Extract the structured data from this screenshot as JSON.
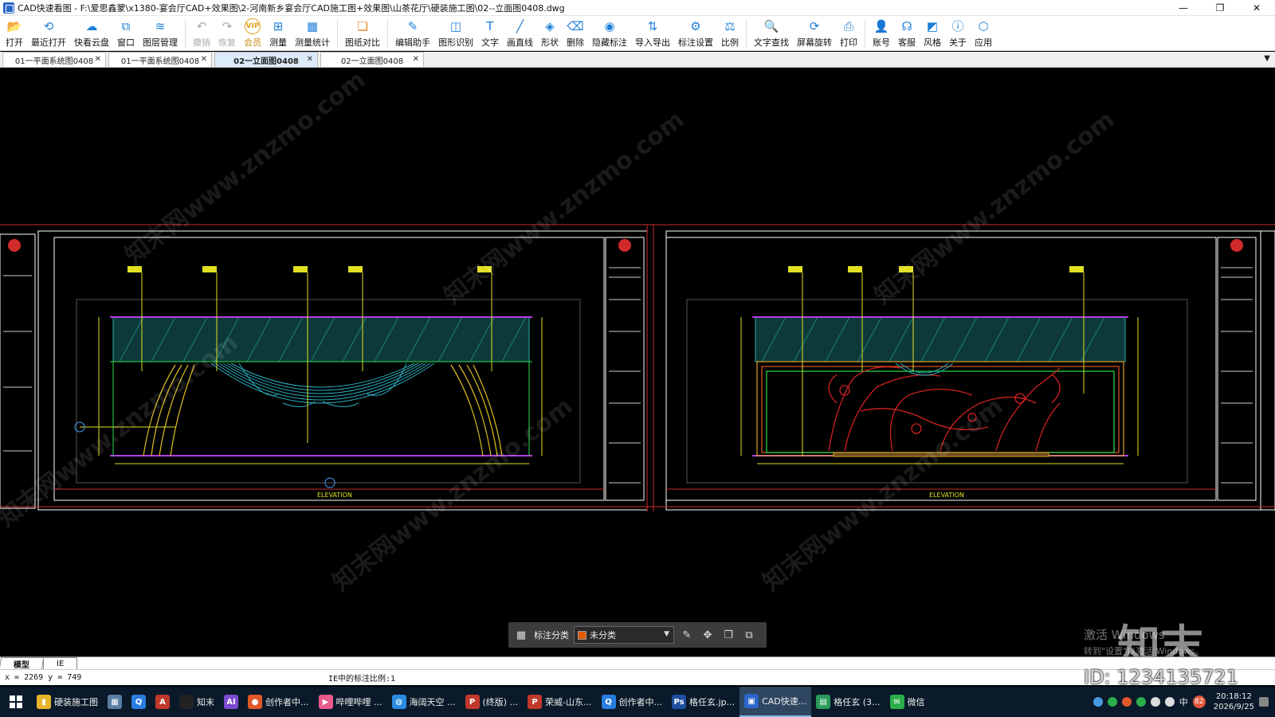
{
  "window": {
    "title": "CAD快速看图 - F:\\爱思鑫蒙\\x1380-宴会厅CAD+效果图\\2-河南新乡宴会厅CAD施工图+效果图\\山茶花厅\\硬装施工图\\02--立面图0408.dwg",
    "controls": [
      "—",
      "❐",
      "✕"
    ]
  },
  "toolbar": {
    "items": [
      {
        "label": "打开",
        "icon": "folder-open-icon",
        "glyph": "📂"
      },
      {
        "label": "最近打开",
        "icon": "history-icon",
        "glyph": "⟲"
      },
      {
        "label": "快看云盘",
        "icon": "cloud-icon",
        "glyph": "☁"
      },
      {
        "label": "窗口",
        "icon": "window-icon",
        "glyph": "⧉"
      },
      {
        "label": "图层管理",
        "icon": "layers-icon",
        "glyph": "≋"
      },
      {
        "label": "撤销",
        "icon": "undo-icon",
        "glyph": "↶"
      },
      {
        "label": "恢复",
        "icon": "redo-icon",
        "glyph": "↷"
      },
      {
        "label": "会员",
        "icon": "vip-icon",
        "glyph": "VIP"
      },
      {
        "label": "测量",
        "icon": "ruler-icon",
        "glyph": "⊞"
      },
      {
        "label": "测量统计",
        "icon": "measure-stats-icon",
        "glyph": "▦"
      },
      {
        "label": "图纸对比",
        "icon": "compare-icon",
        "glyph": "❏"
      },
      {
        "label": "编辑助手",
        "icon": "edit-assist-icon",
        "glyph": "✎"
      },
      {
        "label": "图形识别",
        "icon": "shape-recognize-icon",
        "glyph": "◫"
      },
      {
        "label": "文字",
        "icon": "text-icon",
        "glyph": "T"
      },
      {
        "label": "画直线",
        "icon": "line-icon",
        "glyph": "╱"
      },
      {
        "label": "形状",
        "icon": "shape-icon",
        "glyph": "◈"
      },
      {
        "label": "删除",
        "icon": "eraser-icon",
        "glyph": "⌫"
      },
      {
        "label": "隐藏标注",
        "icon": "hide-annotation-icon",
        "glyph": "◉"
      },
      {
        "label": "导入导出",
        "icon": "import-export-icon",
        "glyph": "⇅"
      },
      {
        "label": "标注设置",
        "icon": "annotation-settings-icon",
        "glyph": "⚙"
      },
      {
        "label": "比例",
        "icon": "scale-icon",
        "glyph": "⚖"
      },
      {
        "label": "文字查找",
        "icon": "text-search-icon",
        "glyph": "🔍"
      },
      {
        "label": "屏幕旋转",
        "icon": "rotate-screen-icon",
        "glyph": "⟳"
      },
      {
        "label": "打印",
        "icon": "print-icon",
        "glyph": "⎙"
      },
      {
        "label": "账号",
        "icon": "account-icon",
        "glyph": "👤"
      },
      {
        "label": "客服",
        "icon": "support-icon",
        "glyph": "☊"
      },
      {
        "label": "风格",
        "icon": "style-icon",
        "glyph": "◩"
      },
      {
        "label": "关于",
        "icon": "about-icon",
        "glyph": "ⓘ"
      },
      {
        "label": "应用",
        "icon": "apps-icon",
        "glyph": "⬡"
      }
    ]
  },
  "tabs": [
    {
      "label": "01一平面系统图0408",
      "active": false
    },
    {
      "label": "01一平面系统图0408",
      "active": false
    },
    {
      "label": "02一立面图0408",
      "active": true
    },
    {
      "label": "02一立面图0408",
      "active": false
    }
  ],
  "tab_dropdown": "▼",
  "drawing": {
    "watermark_text": "知末网www.znzmo.com",
    "left_title": "ELEVATION",
    "right_title": "ELEVATION"
  },
  "annotation_bar": {
    "label": "标注分类",
    "selected": "未分类",
    "swatch_color": "#e05a00"
  },
  "layout_tabs": [
    "模型",
    "IE"
  ],
  "status": {
    "coords": "x = 2269  y = 749",
    "scale_text": "IE中的标注比例:1"
  },
  "overlay": {
    "activation_line1": "激活 Windows",
    "activation_line2": "转到\"设置\"以激活 Windows。",
    "brand": "知末",
    "id_text": "ID: 1234135721"
  },
  "taskbar": {
    "items": [
      {
        "label": "硬装施工图",
        "color": "#e8b52a",
        "glyph": "▮"
      },
      {
        "label": "",
        "color": "#5a7fa6",
        "glyph": "▦"
      },
      {
        "label": "",
        "color": "#2a7de1",
        "glyph": "Q"
      },
      {
        "label": "",
        "color": "#c0392b",
        "glyph": "A"
      },
      {
        "label": "知末",
        "color": "#222222",
        "glyph": ""
      },
      {
        "label": "",
        "color": "#7b4bd1",
        "glyph": "AI"
      },
      {
        "label": "创作者中...",
        "color": "#e0582a",
        "glyph": "●"
      },
      {
        "label": "哔哩哔哩 ...",
        "color": "#ea5a8a",
        "glyph": "▶"
      },
      {
        "label": "海阔天空 ...",
        "color": "#2a8be1",
        "glyph": "◍"
      },
      {
        "label": "(终版) ...",
        "color": "#c0392b",
        "glyph": "P"
      },
      {
        "label": "荣威-山东...",
        "color": "#c0392b",
        "glyph": "P"
      },
      {
        "label": "创作者中...",
        "color": "#2a7de1",
        "glyph": "Q"
      },
      {
        "label": "格任玄.jp...",
        "color": "#1f4fa0",
        "glyph": "Ps"
      },
      {
        "label": "CAD快速...",
        "color": "#2a66c8",
        "glyph": "▣"
      },
      {
        "label": "格任玄 (3...",
        "color": "#2a9a5a",
        "glyph": "▤"
      },
      {
        "label": "微信",
        "color": "#2aae4a",
        "glyph": "✉"
      }
    ],
    "active_index": 13,
    "ime": "中",
    "badge": "82",
    "time": "20:18:12",
    "date": "2026/9/25"
  }
}
